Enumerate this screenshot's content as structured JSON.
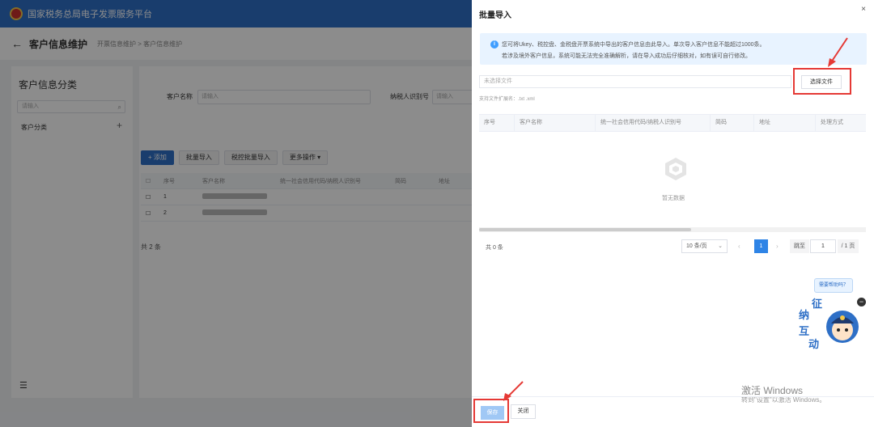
{
  "colors": {
    "primary": "#2e6fc6",
    "annotation": "#e53935",
    "notice_bg": "#e8f3ff"
  },
  "topbar": {
    "title": "国家税务总局电子发票服务平台"
  },
  "page": {
    "back_icon": "arrow-left-icon",
    "title": "客户信息维护",
    "breadcrumb": "开票信息维护 > 客户信息维护"
  },
  "sidebar": {
    "title": "客户信息分类",
    "search_placeholder": "请输入",
    "tree_item": "客户分类"
  },
  "filters": [
    {
      "label": "客户名称",
      "placeholder": "请输入"
    },
    {
      "label": "纳税人识别号",
      "placeholder": "请输入"
    }
  ],
  "toolbar": {
    "add": "+ 添加",
    "batch_import": "批量导入",
    "tax_batch_import": "税控批量导入",
    "more": "更多操作 ▾"
  },
  "bg_table": {
    "columns": [
      "序号",
      "客户名称",
      "统一社会信用代码/纳税人识别号",
      "简码",
      "地址"
    ],
    "rows": [
      {
        "index": "1"
      },
      {
        "index": "2"
      }
    ],
    "total": "共 2 条"
  },
  "drawer": {
    "title": "批量导入",
    "close": "×",
    "notice_line1": "您可将Ukey、税控盘、金税盘开票系统中导出的客户信息由此导入。单次导入客户信息不能超过1000条。",
    "notice_line2": "若涉及境外客户信息，系统可能无法完全准确解析，请在导入成功后仔细核对，如有误可自行修改。",
    "file_placeholder": "未选择文件",
    "choose_file": "选择文件",
    "ext_hint": "支持文件扩展名：.txt .xml",
    "columns": [
      "序号",
      "客户名称",
      "统一社会信用代码/纳税人识别号",
      "简码",
      "地址",
      "处理方式"
    ],
    "empty_text": "暂无数据",
    "total": "共 0 条",
    "page_size": "10 条/页",
    "current_page": "1",
    "goto_label": "跳至",
    "goto_value": "1",
    "goto_total": "/ 1 页",
    "help_bubble": "需要帮助吗？",
    "assistant_text": [
      "征",
      "纳",
      "互",
      "动"
    ],
    "save": "保存",
    "close_btn": "关闭"
  },
  "watermark": {
    "line1": "激活 Windows",
    "line2": "转到\"设置\"以激活 Windows。"
  }
}
